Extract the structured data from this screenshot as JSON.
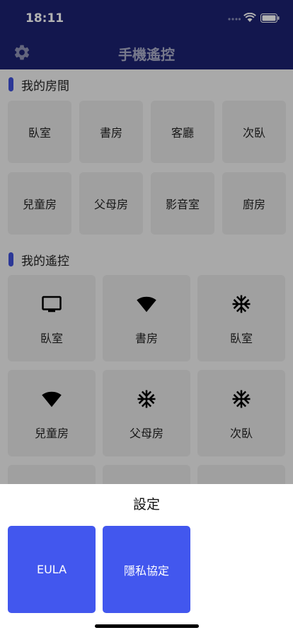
{
  "status_bar": {
    "time": "18:11"
  },
  "header": {
    "title": "手機遙控",
    "settings_icon": "gear-icon"
  },
  "my_rooms": {
    "title": "我的房間",
    "rooms": [
      "臥室",
      "書房",
      "客廳",
      "次臥",
      "兒童房",
      "父母房",
      "影音室",
      "廚房"
    ]
  },
  "my_remotes": {
    "title": "我的遙控",
    "items": [
      {
        "label": "臥室",
        "icon": "tv-icon"
      },
      {
        "label": "書房",
        "icon": "wifi-icon"
      },
      {
        "label": "臥室",
        "icon": "snowflake-icon"
      },
      {
        "label": "兒童房",
        "icon": "wifi-icon"
      },
      {
        "label": "父母房",
        "icon": "snowflake-icon"
      },
      {
        "label": "次臥",
        "icon": "snowflake-icon"
      }
    ]
  },
  "settings_sheet": {
    "title": "設定",
    "buttons": [
      "EULA",
      "隱私協定"
    ]
  },
  "colors": {
    "nav": "#1c2270",
    "accent": "#4257ee"
  }
}
